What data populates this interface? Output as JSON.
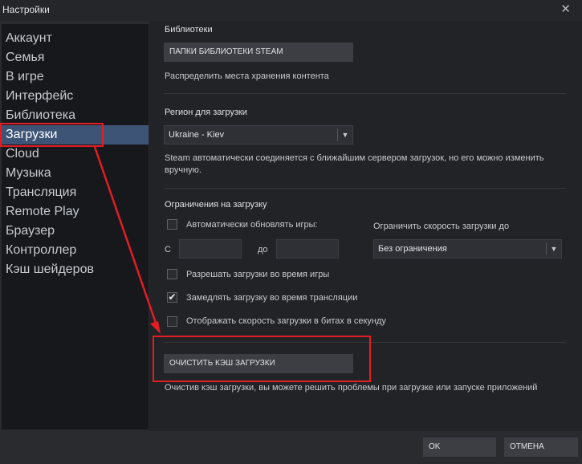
{
  "window": {
    "title": "Настройки",
    "close_glyph": "✕"
  },
  "sidebar": {
    "items": [
      {
        "label": "Аккаунт"
      },
      {
        "label": "Семья"
      },
      {
        "label": "В игре"
      },
      {
        "label": "Интерфейс"
      },
      {
        "label": "Библиотека"
      },
      {
        "label": "Загрузки",
        "active": true
      },
      {
        "label": "Cloud"
      },
      {
        "label": "Музыка"
      },
      {
        "label": "Трансляция"
      },
      {
        "label": "Remote Play"
      },
      {
        "label": "Браузер"
      },
      {
        "label": "Контроллер"
      },
      {
        "label": "Кэш шейдеров"
      }
    ]
  },
  "libraries": {
    "title": "Библиотеки",
    "folders_button": "ПАПКИ БИБЛИОТЕКИ STEAM",
    "description": "Распределить места хранения контента"
  },
  "region": {
    "title": "Регион для загрузки",
    "selected": "Ukraine - Kiev",
    "description": "Steam автоматически соединяется с ближайшим сервером загрузок, но его можно изменить вручную."
  },
  "limits": {
    "title": "Ограничения на загрузку",
    "auto_update_label": "Автоматически обновлять игры:",
    "auto_update_checked": false,
    "from_label": "С",
    "to_label": "до",
    "from_value": "",
    "to_value": "",
    "speed_limit_label": "Ограничить скорость загрузки до",
    "speed_limit_selected": "Без ограничения",
    "allow_during_game_label": "Разрешать загрузки во время игры",
    "allow_during_game_checked": false,
    "throttle_stream_label": "Замедлять загрузку во время трансляции",
    "throttle_stream_checked": true,
    "show_bits_label": "Отображать скорость загрузки в битах в секунду",
    "show_bits_checked": false
  },
  "cache": {
    "clear_button": "ОЧИСТИТЬ КЭШ ЗАГРУЗКИ",
    "description": "Очистив кэш загрузки, вы можете решить проблемы при загрузке или запуске приложений"
  },
  "footer": {
    "ok_label": "OK",
    "cancel_label": "ОТМЕНА"
  },
  "icons": {
    "check": "✔",
    "dropdown": "▼"
  },
  "colors": {
    "accent_active": "#3e5476",
    "annotation": "#e21d24"
  }
}
